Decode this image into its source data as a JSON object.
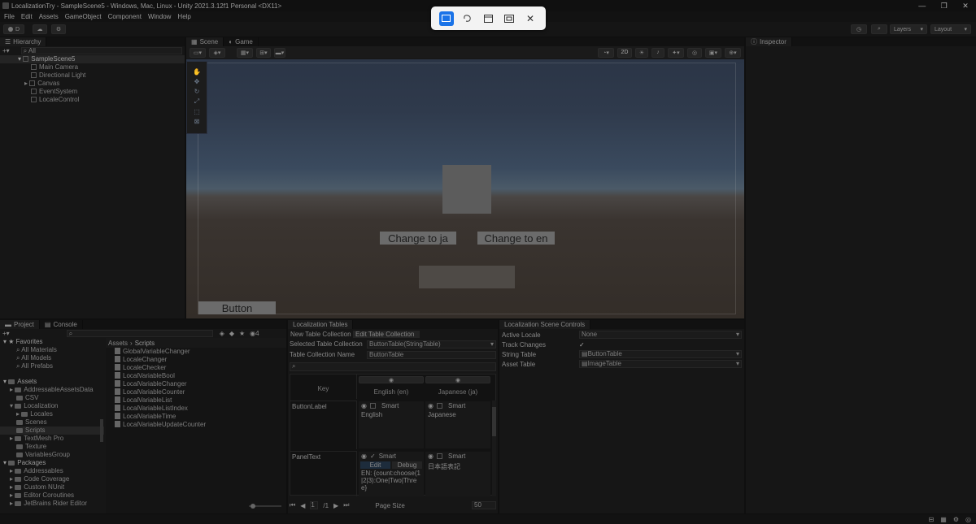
{
  "window": {
    "title": "LocalizationTry - SampleScene5 - Windows, Mac, Linux - Unity 2021.3.12f1 Personal <DX11>"
  },
  "menu": [
    "File",
    "Edit",
    "Assets",
    "GameObject",
    "Component",
    "Window",
    "Help"
  ],
  "toolbar": {
    "account": "D",
    "layers": "Layers",
    "layout": "Layout"
  },
  "hierarchy": {
    "tab": "Hierarchy",
    "search_placeholder": "All",
    "scene": "SampleScene5",
    "items": [
      "Main Camera",
      "Directional Light",
      "Canvas",
      "EventSystem",
      "LocaleControl"
    ]
  },
  "scene_view": {
    "tabs": [
      "Scene",
      "Game"
    ],
    "mode_2d": "2D",
    "buttons": {
      "change_ja": "Change to ja",
      "change_en": "Change to en",
      "button": "Button"
    }
  },
  "inspector": {
    "tab": "Inspector"
  },
  "project": {
    "tabs": [
      "Project",
      "Console"
    ],
    "favorites": {
      "label": "Favorites",
      "items": [
        "All Materials",
        "All Models",
        "All Prefabs"
      ]
    },
    "assets": {
      "label": "Assets",
      "items": [
        "AddressableAssetsData",
        "CSV",
        "Localization",
        "Locales",
        "Scenes",
        "Scripts",
        "TextMesh Pro",
        "Texture",
        "VariablesGroup"
      ]
    },
    "packages": {
      "label": "Packages",
      "items": [
        "Addressables",
        "Code Coverage",
        "Custom NUnit",
        "Editor Coroutines",
        "JetBrains Rider Editor"
      ]
    },
    "breadcrumb": {
      "root": "Assets",
      "sep": "›",
      "current": "Scripts"
    },
    "hidden_count": "4",
    "scripts": [
      "GlobalVariableChanger",
      "LocaleChanger",
      "LocaleChecker",
      "LocalVariableBool",
      "LocalVariableChanger",
      "LocalVariableCounter",
      "LocalVariableList",
      "LocalVariableListIndex",
      "LocalVariableTime",
      "LocalVariableUpdateCounter"
    ]
  },
  "loc_tables": {
    "tab": "Localization Tables",
    "new_btn": "New Table Collection",
    "edit_btn": "Edit Table Collection",
    "selected_label": "Selected Table Collection",
    "selected_value": "ButtonTable(StringTable)",
    "name_label": "Table Collection Name",
    "name_value": "ButtonTable",
    "col_key": "Key",
    "col_en": "English (en)",
    "col_ja": "Japanese (ja)",
    "smart": "Smart",
    "rows": [
      {
        "key": "ButtonLabel",
        "en": "English",
        "ja": "Japanese"
      },
      {
        "key": "PanelText",
        "en": "EN: {count:choose(1|2|3):One|Two|Three}",
        "ja": "日本語表記"
      }
    ],
    "edit_tab": "Edit",
    "debug_tab": "Debug",
    "page": "1",
    "page_total": "/1",
    "page_size_label": "Page Size",
    "page_size": "50"
  },
  "scene_controls": {
    "tab": "Localization Scene Controls",
    "active_locale_label": "Active Locale",
    "active_locale": "None",
    "track_label": "Track Changes",
    "track": "✓",
    "string_table_label": "String Table",
    "string_table": "ButtonTable",
    "asset_table_label": "Asset Table",
    "asset_table": "ImageTable"
  }
}
